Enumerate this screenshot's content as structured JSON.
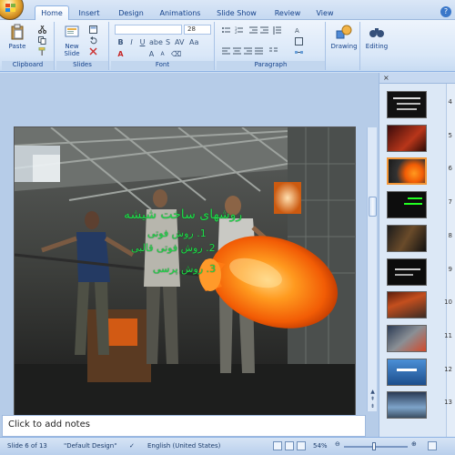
{
  "ribbon": {
    "tabs": [
      "Home",
      "Insert",
      "Design",
      "Animations",
      "Slide Show",
      "Review",
      "View"
    ],
    "active_tab": "Home",
    "groups": {
      "clipboard": {
        "label": "Clipboard",
        "paste": "Paste"
      },
      "slides": {
        "label": "Slides",
        "new_slide": "New Slide"
      },
      "font": {
        "label": "Font",
        "size": "28"
      },
      "paragraph": {
        "label": "Paragraph"
      },
      "drawing": {
        "label": "Drawing"
      },
      "editing": {
        "label": "Editing"
      }
    }
  },
  "slide": {
    "title": "روشهای ساخت شیشه",
    "items": [
      "1. روش فوتی",
      "2. روش فوتی قالبی",
      "3. روش پرسی"
    ]
  },
  "thumbnails": [
    {
      "num": "4"
    },
    {
      "num": "5"
    },
    {
      "num": "6",
      "selected": true
    },
    {
      "num": "7"
    },
    {
      "num": "8"
    },
    {
      "num": "9"
    },
    {
      "num": "10"
    },
    {
      "num": "11"
    },
    {
      "num": "12"
    },
    {
      "num": "13"
    }
  ],
  "notes": {
    "placeholder": "Click to add notes"
  },
  "status": {
    "slide_info": "Slide 6 of 13",
    "theme": "\"Default Design\"",
    "language": "English (United States)",
    "zoom": "54%"
  },
  "colors": {
    "accent": "#f29536",
    "ribbon_text": "#15428b",
    "slide_text": "#21d94b"
  }
}
